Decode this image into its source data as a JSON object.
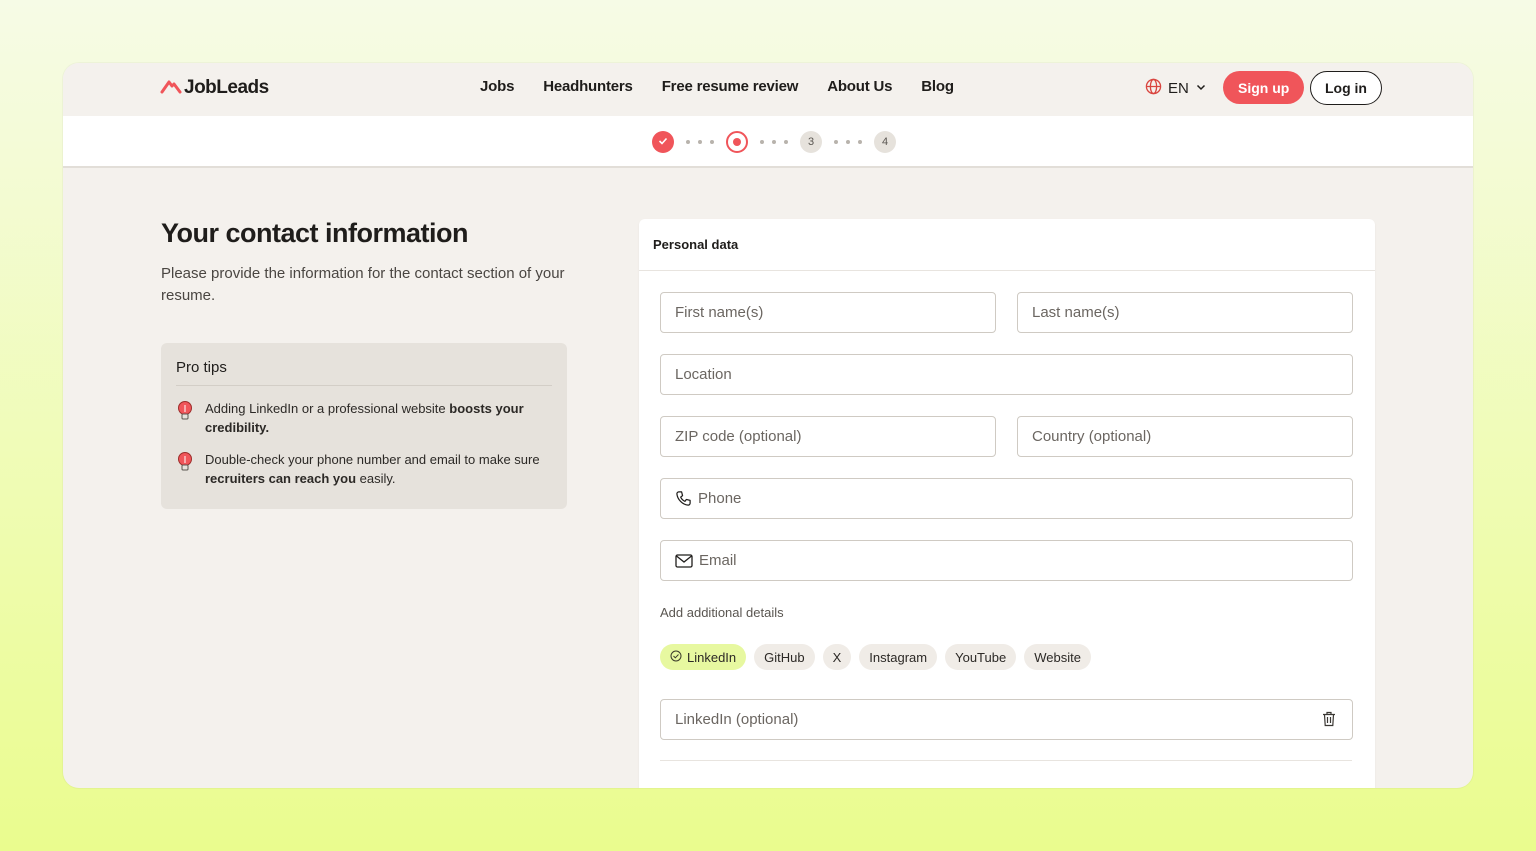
{
  "brand": {
    "name": "JobLeads"
  },
  "nav": [
    "Jobs",
    "Headhunters",
    "Free resume review",
    "About Us",
    "Blog"
  ],
  "lang": {
    "label": "EN"
  },
  "auth": {
    "signup": "Sign up",
    "login": "Log in"
  },
  "steps": [
    {
      "state": "done",
      "label": ""
    },
    {
      "state": "active",
      "label": ""
    },
    {
      "state": "todo",
      "label": "3"
    },
    {
      "state": "todo",
      "label": "4"
    }
  ],
  "intro": {
    "title": "Your contact information",
    "subtitle": "Please provide the information for the contact section of your resume."
  },
  "tips": {
    "title": "Pro tips",
    "items": [
      {
        "pre": "Adding LinkedIn or a professional website ",
        "bold": "boosts your credibility.",
        "post": ""
      },
      {
        "pre": "Double-check your phone number and email to make sure ",
        "bold": "recruiters can reach you",
        "post": " easily."
      }
    ]
  },
  "form": {
    "section_title": "Personal data",
    "first_name": "First name(s)",
    "last_name": "Last name(s)",
    "location": "Location",
    "zip": "ZIP code (optional)",
    "country": "Country (optional)",
    "phone": "Phone",
    "email": "Email",
    "additional_label": "Add additional details",
    "chips": [
      "LinkedIn",
      "GitHub",
      "X",
      "Instagram",
      "YouTube",
      "Website"
    ],
    "selected_chip": "LinkedIn",
    "linkedin": "LinkedIn (optional)"
  },
  "colors": {
    "accent": "#f0555a",
    "selected_chip": "#e7f8a0"
  }
}
